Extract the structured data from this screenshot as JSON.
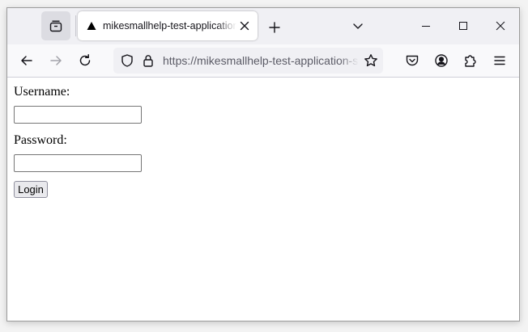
{
  "browser": {
    "tab": {
      "title": "mikesmallhelp-test-application-s",
      "favicon": "triangle-icon"
    },
    "urlbar": {
      "url": "https://mikesmallhelp-test-application-s"
    },
    "icons": {
      "tabs_list": "tab-overview-icon",
      "close_tab": "close-icon",
      "new_tab": "plus-icon",
      "list_all_tabs": "chevron-down-icon",
      "minimize": "minimize-icon",
      "maximize": "maximize-icon",
      "close_window": "close-icon",
      "back": "arrow-left-icon",
      "forward": "arrow-right-icon",
      "reload": "reload-icon",
      "tracking_protection": "shield-icon",
      "secure": "lock-icon",
      "bookmark": "star-icon",
      "pocket": "pocket-icon",
      "account": "account-icon",
      "extensions": "puzzle-icon",
      "menu": "hamburger-icon"
    }
  },
  "page": {
    "username_label": "Username:",
    "username_value": "",
    "password_label": "Password:",
    "password_value": "",
    "login_button": "Login"
  }
}
